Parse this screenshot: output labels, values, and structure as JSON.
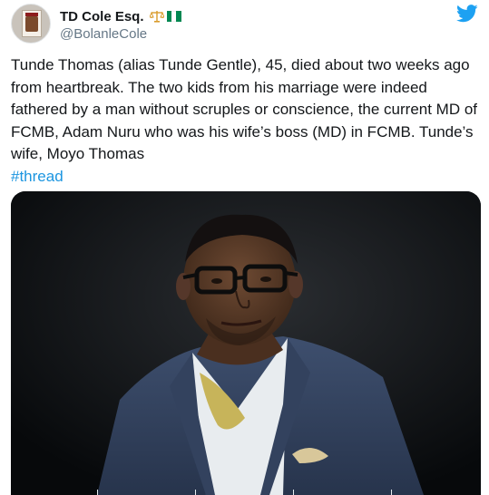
{
  "author": {
    "name": "TD Cole Esq.",
    "handle": "@BolanleCole",
    "badges": [
      "scales-icon",
      "nigeria-flag-icon"
    ]
  },
  "tweet": {
    "text": "Tunde Thomas (alias Tunde Gentle), 45, died about two weeks ago from heartbreak. The two kids from his marriage were indeed fathered by a man without scruples or conscience, the current MD of FCMB, Adam Nuru who was his wife’s boss (MD) in FCMB. Tunde’s wife, Moyo Thomas",
    "hashtag": "#thread"
  },
  "media": {
    "icon": "portrait-photo"
  },
  "colors": {
    "link": "#1b95e0",
    "twitter_blue": "#1da1f2",
    "flag_green": "#008751"
  }
}
